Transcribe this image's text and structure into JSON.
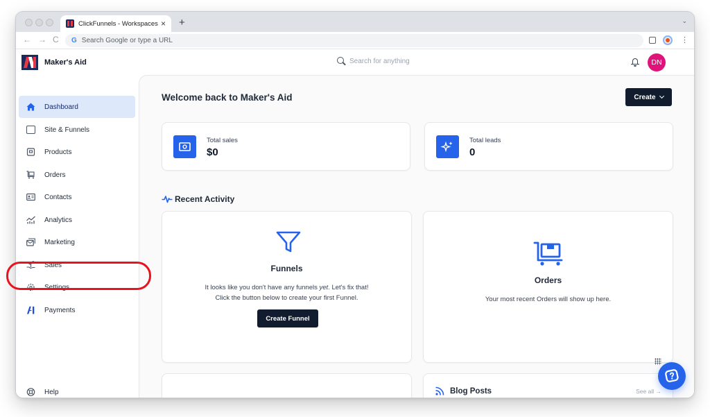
{
  "browser": {
    "tab_title": "ClickFunnels - Workspaces",
    "tab_close": "×",
    "new_tab": "+",
    "omnibox_placeholder": "Search Google or type a URL",
    "back": "←",
    "forward": "→",
    "reload": "C",
    "google_glyph": "G",
    "menu_glyph": "⋮",
    "tabstrip_chevron": "⌄"
  },
  "app": {
    "workspace_name": "Maker's Aid",
    "search_placeholder": "Search for anything",
    "avatar_initials": "DN",
    "accent_color": "#2563eb",
    "avatar_color": "#e0137a"
  },
  "sidebar": {
    "items": [
      {
        "label": "Dashboard",
        "icon": "home-icon",
        "active": true
      },
      {
        "label": "Site & Funnels",
        "icon": "browser-window-icon"
      },
      {
        "label": "Products",
        "icon": "package-icon"
      },
      {
        "label": "Orders",
        "icon": "cart-icon"
      },
      {
        "label": "Contacts",
        "icon": "contact-card-icon"
      },
      {
        "label": "Analytics",
        "icon": "analytics-chart-icon"
      },
      {
        "label": "Marketing",
        "icon": "mail-stack-icon"
      },
      {
        "label": "Sales",
        "icon": "sales-plant-icon"
      },
      {
        "label": "Settings",
        "icon": "gear-icon"
      },
      {
        "label": "Payments",
        "icon": "payments-logo-icon"
      }
    ],
    "help_label": "Help"
  },
  "main": {
    "welcome": "Welcome back to Maker's Aid",
    "create_label": "Create",
    "stats": [
      {
        "label": "Total sales",
        "value": "$0",
        "icon": "money-icon"
      },
      {
        "label": "Total leads",
        "value": "0",
        "icon": "sparkles-icon"
      }
    ],
    "recent_activity_title": "Recent Activity",
    "funnels": {
      "title": "Funnels",
      "desc_before": "It looks like you don't have any funnels ",
      "desc_emphasis": "yet",
      "desc_after": ". Let's fix that!",
      "desc_line2": "Click the button below to create your first Funnel.",
      "button": "Create Funnel"
    },
    "orders": {
      "title": "Orders",
      "desc": "Your most recent Orders will show up here."
    },
    "blog": {
      "title": "Blog Posts",
      "see_all": "See all →"
    }
  }
}
